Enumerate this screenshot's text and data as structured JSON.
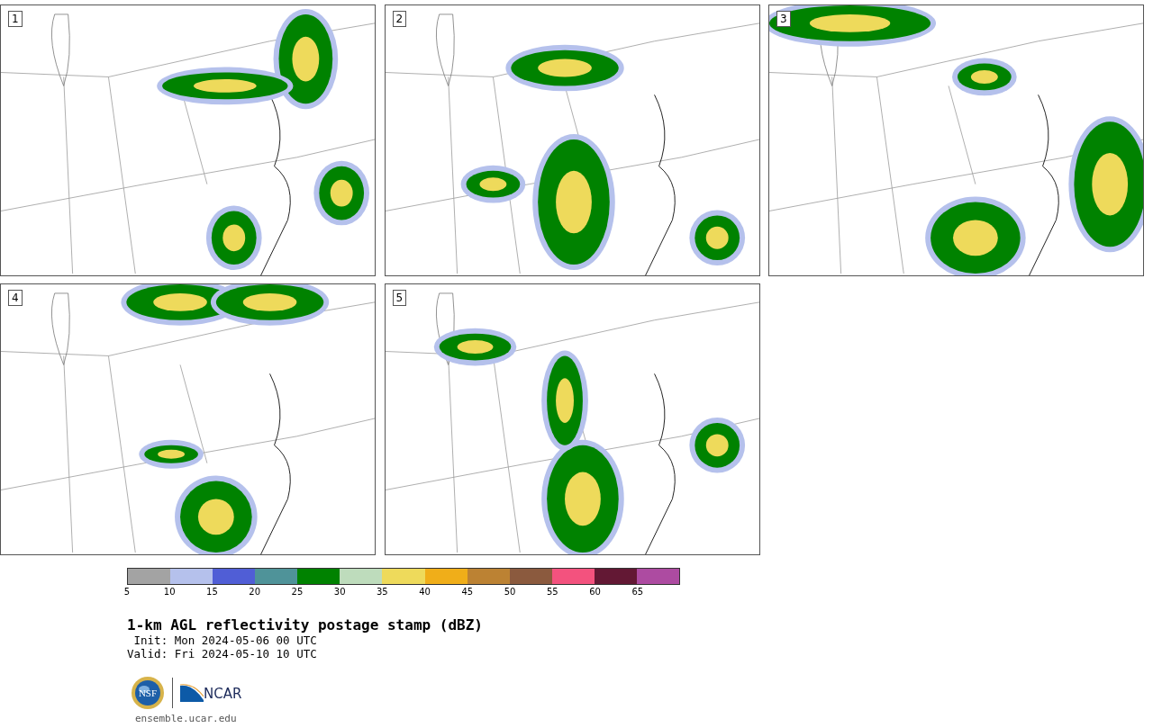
{
  "panels": [
    {
      "number": "1",
      "kind": "picture"
    },
    {
      "number": "2",
      "kind": "picture"
    },
    {
      "number": "3",
      "kind": "picture"
    },
    {
      "number": "4",
      "kind": "picture"
    },
    {
      "number": "5",
      "kind": "picture"
    }
  ],
  "colorbar": {
    "bins": [
      {
        "color": "#a3a3a3"
      },
      {
        "color": "#b5c1ec"
      },
      {
        "color": "#505ed6"
      },
      {
        "color": "#4f9399"
      },
      {
        "color": "#008200"
      },
      {
        "color": "#bedcbc"
      },
      {
        "color": "#eeda5b"
      },
      {
        "color": "#f0ae19"
      },
      {
        "color": "#bc8233"
      },
      {
        "color": "#8b5a3e"
      },
      {
        "color": "#f3527e"
      },
      {
        "color": "#631834"
      },
      {
        "color": "#ad4ba1"
      }
    ],
    "ticks": [
      "5",
      "10",
      "15",
      "20",
      "25",
      "30",
      "35",
      "40",
      "45",
      "50",
      "55",
      "60",
      "65"
    ]
  },
  "title": "1-km AGL reflectivity postage stamp (dBZ)",
  "init": " Init: Mon 2024-05-06 00 UTC",
  "valid": "Valid: Fri 2024-05-10 10 UTC",
  "logos": {
    "nsf": "NSF",
    "ncar": "NCAR"
  },
  "footer_link": "ensemble.ucar.edu"
}
